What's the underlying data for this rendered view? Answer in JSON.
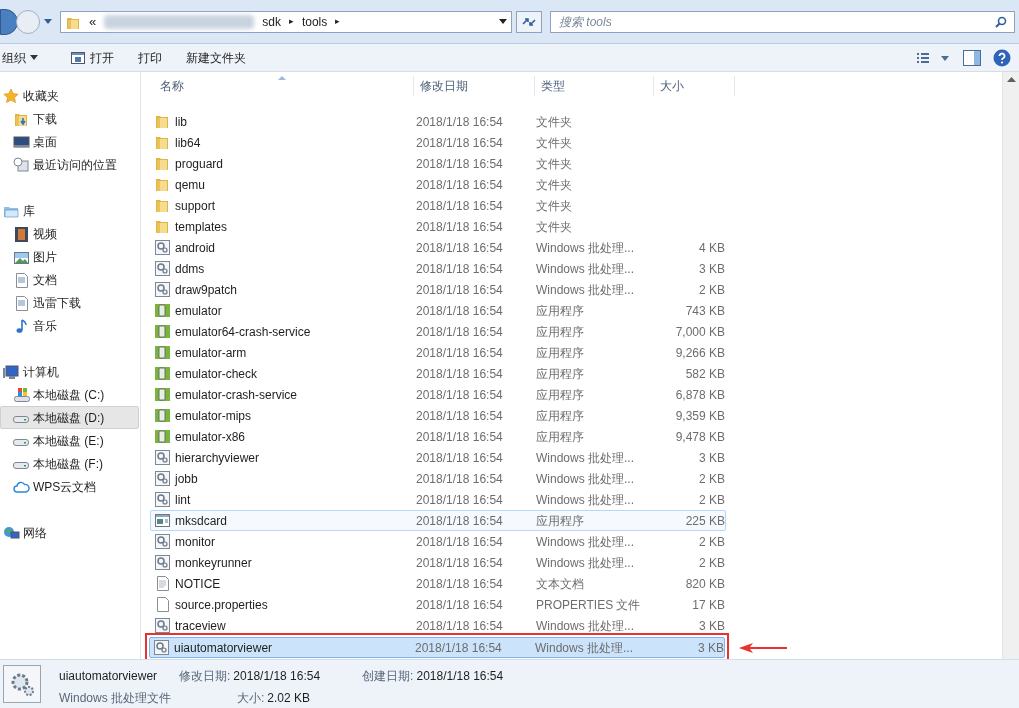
{
  "address_bar": {
    "prefix": "«",
    "segments": [
      "sdk",
      "tools"
    ],
    "separator": "▸"
  },
  "search": {
    "placeholder": "搜索 tools"
  },
  "toolbar": {
    "organize": "组织",
    "buttons": [
      "打开",
      "打印",
      "新建文件夹"
    ]
  },
  "sidebar": {
    "groups": [
      {
        "label": "收藏夹",
        "kind": "favorites",
        "children": [
          {
            "label": "下载",
            "kind": "download",
            "selected": false
          },
          {
            "label": "桌面",
            "kind": "desktop",
            "selected": false
          },
          {
            "label": "最近访问的位置",
            "kind": "recent",
            "selected": false
          }
        ]
      },
      {
        "label": "库",
        "kind": "library",
        "children": [
          {
            "label": "视频",
            "kind": "video",
            "selected": false
          },
          {
            "label": "图片",
            "kind": "image",
            "selected": false
          },
          {
            "label": "文档",
            "kind": "doc",
            "selected": false
          },
          {
            "label": "迅雷下载",
            "kind": "doc",
            "selected": false
          },
          {
            "label": "音乐",
            "kind": "music",
            "selected": false
          }
        ]
      },
      {
        "label": "计算机",
        "kind": "computer",
        "children": [
          {
            "label": "本地磁盘 (C:)",
            "kind": "system-drive",
            "selected": false
          },
          {
            "label": "本地磁盘 (D:)",
            "kind": "drive",
            "selected": true
          },
          {
            "label": "本地磁盘 (E:)",
            "kind": "drive",
            "selected": false
          },
          {
            "label": "本地磁盘 (F:)",
            "kind": "drive",
            "selected": false
          },
          {
            "label": "WPS云文档",
            "kind": "cloud",
            "selected": false
          }
        ]
      },
      {
        "label": "网络",
        "kind": "network"
      }
    ]
  },
  "table": {
    "columns": [
      "名称",
      "修改日期",
      "类型",
      "大小"
    ],
    "rows": [
      {
        "name": "lib",
        "date": "2018/1/18 16:54",
        "type": "文件夹",
        "kind": "folder",
        "selected": false,
        "hovered": false,
        "annotated": false
      },
      {
        "name": "lib64",
        "date": "2018/1/18 16:54",
        "type": "文件夹",
        "kind": "folder",
        "selected": false,
        "hovered": false,
        "annotated": false
      },
      {
        "name": "proguard",
        "date": "2018/1/18 16:54",
        "type": "文件夹",
        "kind": "folder",
        "selected": false,
        "hovered": false,
        "annotated": false
      },
      {
        "name": "qemu",
        "date": "2018/1/18 16:54",
        "type": "文件夹",
        "kind": "folder",
        "selected": false,
        "hovered": false,
        "annotated": false
      },
      {
        "name": "support",
        "date": "2018/1/18 16:54",
        "type": "文件夹",
        "kind": "folder",
        "selected": false,
        "hovered": false,
        "annotated": false
      },
      {
        "name": "templates",
        "date": "2018/1/18 16:54",
        "type": "文件夹",
        "kind": "folder",
        "selected": false,
        "hovered": false,
        "annotated": false
      },
      {
        "name": "android",
        "date": "2018/1/18 16:54",
        "type": "Windows 批处理...",
        "size": "4 KB",
        "kind": "batch",
        "selected": false,
        "hovered": false,
        "annotated": false
      },
      {
        "name": "ddms",
        "date": "2018/1/18 16:54",
        "type": "Windows 批处理...",
        "size": "3 KB",
        "kind": "batch",
        "selected": false,
        "hovered": false,
        "annotated": false
      },
      {
        "name": "draw9patch",
        "date": "2018/1/18 16:54",
        "type": "Windows 批处理...",
        "size": "2 KB",
        "kind": "batch",
        "selected": false,
        "hovered": false,
        "annotated": false
      },
      {
        "name": "emulator",
        "date": "2018/1/18 16:54",
        "type": "应用程序",
        "size": "743 KB",
        "kind": "app",
        "selected": false,
        "hovered": false,
        "annotated": false
      },
      {
        "name": "emulator64-crash-service",
        "date": "2018/1/18 16:54",
        "type": "应用程序",
        "size": "7,000 KB",
        "kind": "app",
        "selected": false,
        "hovered": false,
        "annotated": false
      },
      {
        "name": "emulator-arm",
        "date": "2018/1/18 16:54",
        "type": "应用程序",
        "size": "9,266 KB",
        "kind": "app",
        "selected": false,
        "hovered": false,
        "annotated": false
      },
      {
        "name": "emulator-check",
        "date": "2018/1/18 16:54",
        "type": "应用程序",
        "size": "582 KB",
        "kind": "app",
        "selected": false,
        "hovered": false,
        "annotated": false
      },
      {
        "name": "emulator-crash-service",
        "date": "2018/1/18 16:54",
        "type": "应用程序",
        "size": "6,878 KB",
        "kind": "app",
        "selected": false,
        "hovered": false,
        "annotated": false
      },
      {
        "name": "emulator-mips",
        "date": "2018/1/18 16:54",
        "type": "应用程序",
        "size": "9,359 KB",
        "kind": "app",
        "selected": false,
        "hovered": false,
        "annotated": false
      },
      {
        "name": "emulator-x86",
        "date": "2018/1/18 16:54",
        "type": "应用程序",
        "size": "9,478 KB",
        "kind": "app",
        "selected": false,
        "hovered": false,
        "annotated": false
      },
      {
        "name": "hierarchyviewer",
        "date": "2018/1/18 16:54",
        "type": "Windows 批处理...",
        "size": "3 KB",
        "kind": "batch",
        "selected": false,
        "hovered": false,
        "annotated": false
      },
      {
        "name": "jobb",
        "date": "2018/1/18 16:54",
        "type": "Windows 批处理...",
        "size": "2 KB",
        "kind": "batch",
        "selected": false,
        "hovered": false,
        "annotated": false
      },
      {
        "name": "lint",
        "date": "2018/1/18 16:54",
        "type": "Windows 批处理...",
        "size": "2 KB",
        "kind": "batch",
        "selected": false,
        "hovered": false,
        "annotated": false
      },
      {
        "name": "mksdcard",
        "date": "2018/1/18 16:54",
        "type": "应用程序",
        "size": "225 KB",
        "kind": "exe",
        "selected": false,
        "hovered": true,
        "annotated": false
      },
      {
        "name": "monitor",
        "date": "2018/1/18 16:54",
        "type": "Windows 批处理...",
        "size": "2 KB",
        "kind": "batch",
        "selected": false,
        "hovered": false,
        "annotated": false
      },
      {
        "name": "monkeyrunner",
        "date": "2018/1/18 16:54",
        "type": "Windows 批处理...",
        "size": "2 KB",
        "kind": "batch",
        "selected": false,
        "hovered": false,
        "annotated": false
      },
      {
        "name": "NOTICE",
        "date": "2018/1/18 16:54",
        "type": "文本文档",
        "size": "820 KB",
        "kind": "text",
        "selected": false,
        "hovered": false,
        "annotated": false
      },
      {
        "name": "source.properties",
        "date": "2018/1/18 16:54",
        "type": "PROPERTIES 文件",
        "size": "17 KB",
        "kind": "file",
        "selected": false,
        "hovered": false,
        "annotated": false
      },
      {
        "name": "traceview",
        "date": "2018/1/18 16:54",
        "type": "Windows 批处理...",
        "size": "3 KB",
        "kind": "batch",
        "selected": false,
        "hovered": false,
        "annotated": false
      },
      {
        "name": "uiautomatorviewer",
        "date": "2018/1/18 16:54",
        "type": "Windows 批处理...",
        "size": "3 KB",
        "kind": "batch",
        "selected": true,
        "hovered": false,
        "annotated": true
      }
    ]
  },
  "details": {
    "name": "uiautomatorviewer",
    "type": "Windows 批处理文件",
    "fields": [
      {
        "label": "修改日期:",
        "value": "2018/1/18 16:54"
      },
      {
        "label": "大小:",
        "value": "2.02 KB"
      },
      {
        "label": "创建日期:",
        "value": "2018/1/18 16:54"
      }
    ]
  }
}
